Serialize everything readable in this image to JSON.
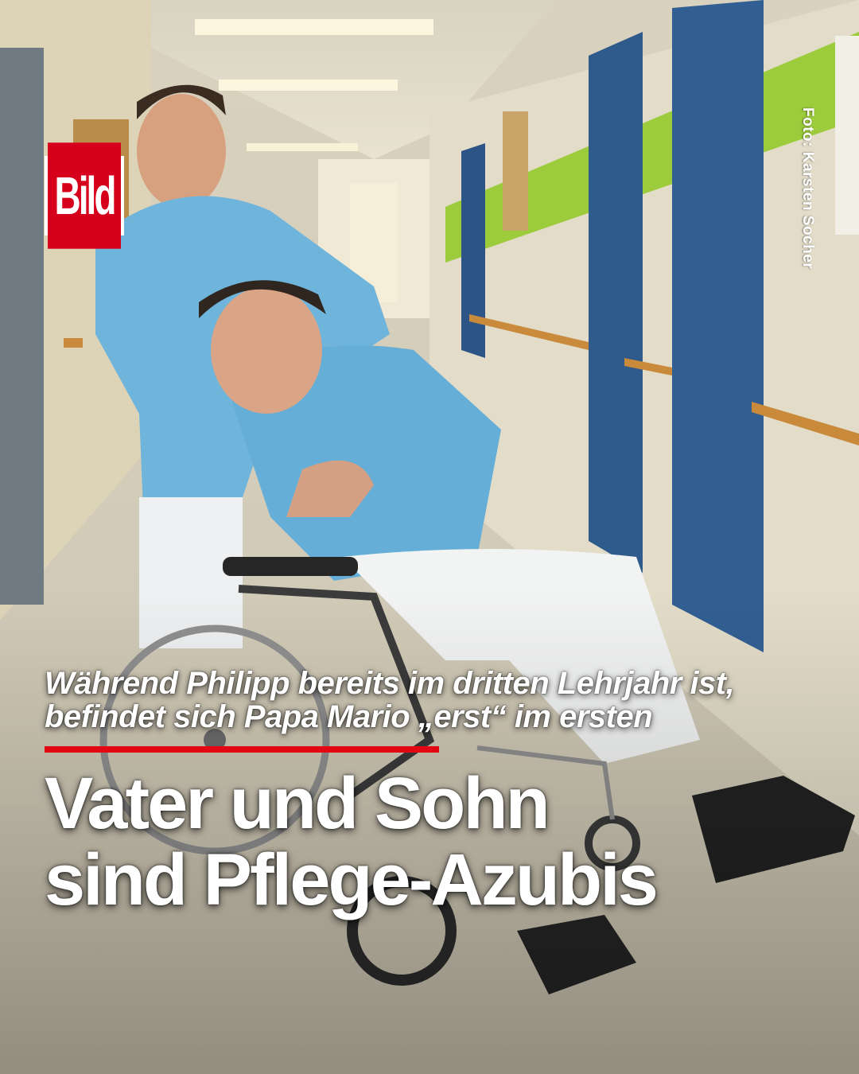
{
  "logo": {
    "text": "Bild",
    "brand_color": "#d6001c"
  },
  "photo_credit": "Foto: Karsten Socher",
  "subline": {
    "lines": [
      "Während Philipp bereits im dritten Lehrjahr ist,",
      "befindet sich Papa Mario „erst“ im ersten"
    ]
  },
  "accent_color": "#e30613",
  "headline": {
    "lines": [
      "Vater und Sohn",
      "sind Pflege-Azubis"
    ]
  }
}
